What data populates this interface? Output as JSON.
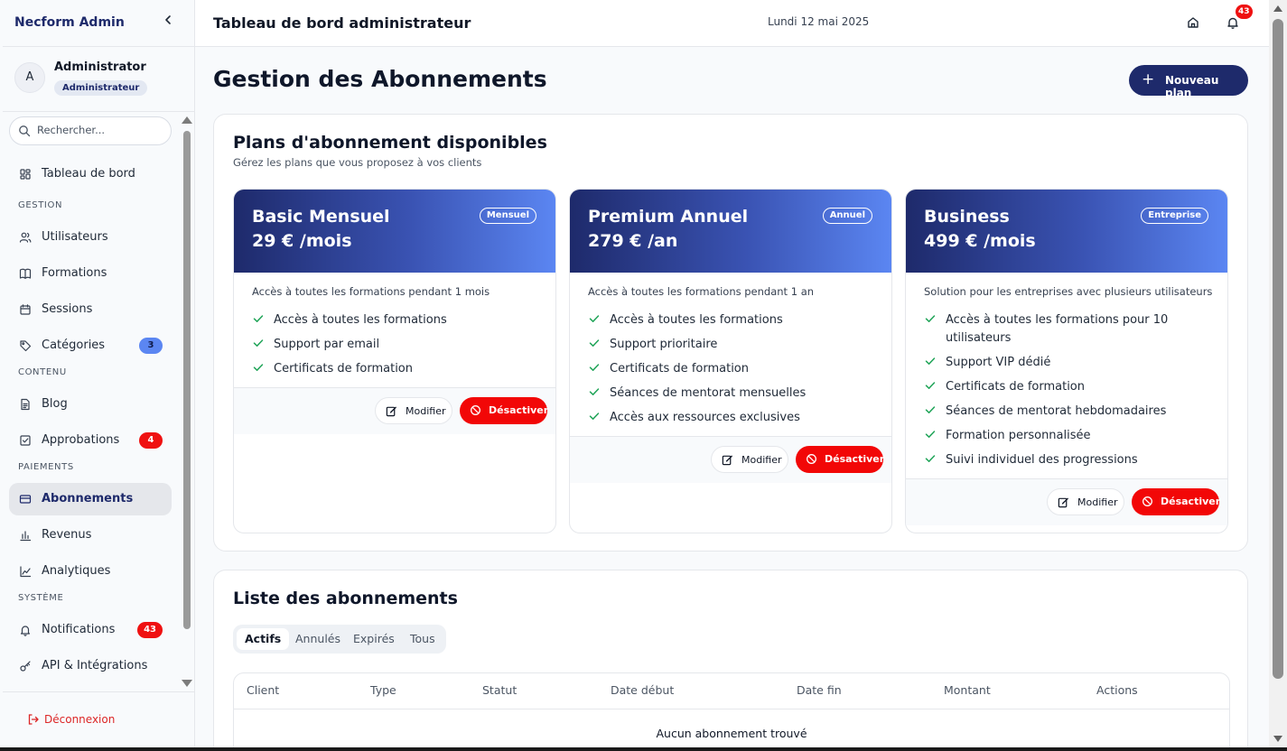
{
  "app": {
    "brand": "Necform Admin",
    "collapse_icon": "chevron-left-icon"
  },
  "profile": {
    "initial": "A",
    "name": "Administrator",
    "role": "Administrateur"
  },
  "search": {
    "placeholder": "Rechercher..."
  },
  "sidebar": {
    "top_item": {
      "label": "Tableau de bord",
      "icon": "dashboard-icon"
    },
    "sections": [
      {
        "label": "GESTION",
        "items": [
          {
            "label": "Utilisateurs",
            "icon": "users-icon"
          },
          {
            "label": "Formations",
            "icon": "book-icon"
          },
          {
            "label": "Sessions",
            "icon": "calendar-icon"
          },
          {
            "label": "Catégories",
            "icon": "tag-icon",
            "badge": "3",
            "badge_color": "#5b86f2"
          }
        ]
      },
      {
        "label": "CONTENU",
        "items": [
          {
            "label": "Blog",
            "icon": "file-text-icon"
          },
          {
            "label": "Approbations",
            "icon": "check-square-icon",
            "badge": "4",
            "badge_color": "#ef1111"
          }
        ]
      },
      {
        "label": "PAIEMENTS",
        "items": [
          {
            "label": "Abonnements",
            "icon": "credit-card-icon",
            "active": true
          },
          {
            "label": "Revenus",
            "icon": "bar-chart-icon"
          },
          {
            "label": "Analytiques",
            "icon": "line-chart-icon"
          }
        ]
      },
      {
        "label": "SYSTÈME",
        "items": [
          {
            "label": "Notifications",
            "icon": "bell-icon",
            "badge": "43",
            "badge_color": "#ef1111"
          },
          {
            "label": "API & Intégrations",
            "icon": "key-icon"
          }
        ]
      }
    ],
    "logout": "Déconnexion"
  },
  "header": {
    "title": "Tableau de bord administrateur",
    "date": "Lundi 12 mai 2025",
    "notification_count": "43"
  },
  "main": {
    "title": "Gestion des Abonnements",
    "new_plan": "Nouveau plan",
    "plans_panel": {
      "title": "Plans d'abonnement disponibles",
      "subtitle": "Gérez les plans que vous proposez à vos clients",
      "edit_label": "Modifier",
      "deactivate_label": "Désactiver",
      "plans": [
        {
          "name": "Basic Mensuel",
          "price": "29 € /mois",
          "tag": "Mensuel",
          "description": "Accès à toutes les formations pendant 1 mois",
          "features": [
            "Accès à toutes les formations",
            "Support par email",
            "Certificats de formation"
          ]
        },
        {
          "name": "Premium Annuel",
          "price": "279 € /an",
          "tag": "Annuel",
          "description": "Accès à toutes les formations pendant 1 an",
          "features": [
            "Accès à toutes les formations",
            "Support prioritaire",
            "Certificats de formation",
            "Séances de mentorat mensuelles",
            "Accès aux ressources exclusives"
          ]
        },
        {
          "name": "Business",
          "price": "499 € /mois",
          "tag": "Entreprise",
          "description": "Solution pour les entreprises avec plusieurs utilisateurs",
          "features": [
            "Accès à toutes les formations pour 10 utilisateurs",
            "Support VIP dédié",
            "Certificats de formation",
            "Séances de mentorat hebdomadaires",
            "Formation personnalisée",
            "Suivi individuel des progressions"
          ]
        }
      ]
    },
    "list_panel": {
      "title": "Liste des abonnements",
      "tabs": [
        "Actifs",
        "Annulés",
        "Expirés",
        "Tous"
      ],
      "active_tab": "Actifs",
      "columns": [
        "Client",
        "Type",
        "Statut",
        "Date début",
        "Date fin",
        "Montant",
        "Actions"
      ],
      "empty_message": "Aucun abonnement trouvé"
    }
  },
  "colors": {
    "brand": "#1e2a6b",
    "danger": "#f20707",
    "accent_blue": "#5b86f2",
    "check_green": "#22a55a"
  }
}
